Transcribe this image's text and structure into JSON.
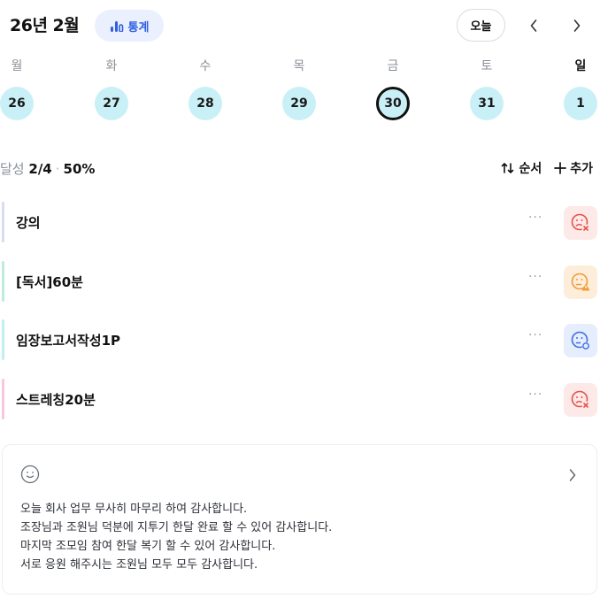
{
  "header": {
    "month_title": "26년 2월",
    "stats_label": "통계",
    "today_label": "오늘"
  },
  "week": {
    "days": [
      {
        "label": "월",
        "date": "26"
      },
      {
        "label": "화",
        "date": "27"
      },
      {
        "label": "수",
        "date": "28"
      },
      {
        "label": "목",
        "date": "29"
      },
      {
        "label": "금",
        "date": "30",
        "selected": true
      },
      {
        "label": "토",
        "date": "31"
      },
      {
        "label": "일",
        "date": "1"
      }
    ]
  },
  "summary": {
    "prefix": "달성",
    "count": "2/4",
    "percent": "50%"
  },
  "actions": {
    "order_label": "순서",
    "add_label": "추가"
  },
  "tasks": [
    {
      "title": "강의",
      "bar_color": "#d9dcf2",
      "status": "failed",
      "status_icon": "sad-x-icon"
    },
    {
      "title": "[독서]60분",
      "bar_color": "#bfeadf",
      "status": "warning",
      "status_icon": "sad-alert-icon"
    },
    {
      "title": "임장보고서작성1P",
      "bar_color": "#bfeff0",
      "status": "pending",
      "status_icon": "neutral-clock-icon"
    },
    {
      "title": "스트레칭20분",
      "bar_color": "#f7c6df",
      "status": "failed",
      "status_icon": "sad-x-icon"
    }
  ],
  "note": {
    "lines": [
      "오늘 회사 업무 무사히 마무리 하여 감사합니다.",
      "조장님과 조원님 덕분에 지투기 한달 완료 할 수 있어 감사합니다.",
      "마지막 조모임 참여 한달 복기 할 수 있어 감사합니다.",
      "서로 응원 해주시는 조원님 모두 모두 감사합니다."
    ]
  },
  "colors": {
    "accent": "#2f5fe0",
    "day_bg": "#c9f0f6",
    "failed": "#e5534b",
    "warning": "#f29b38",
    "pending": "#3d6fe0"
  }
}
